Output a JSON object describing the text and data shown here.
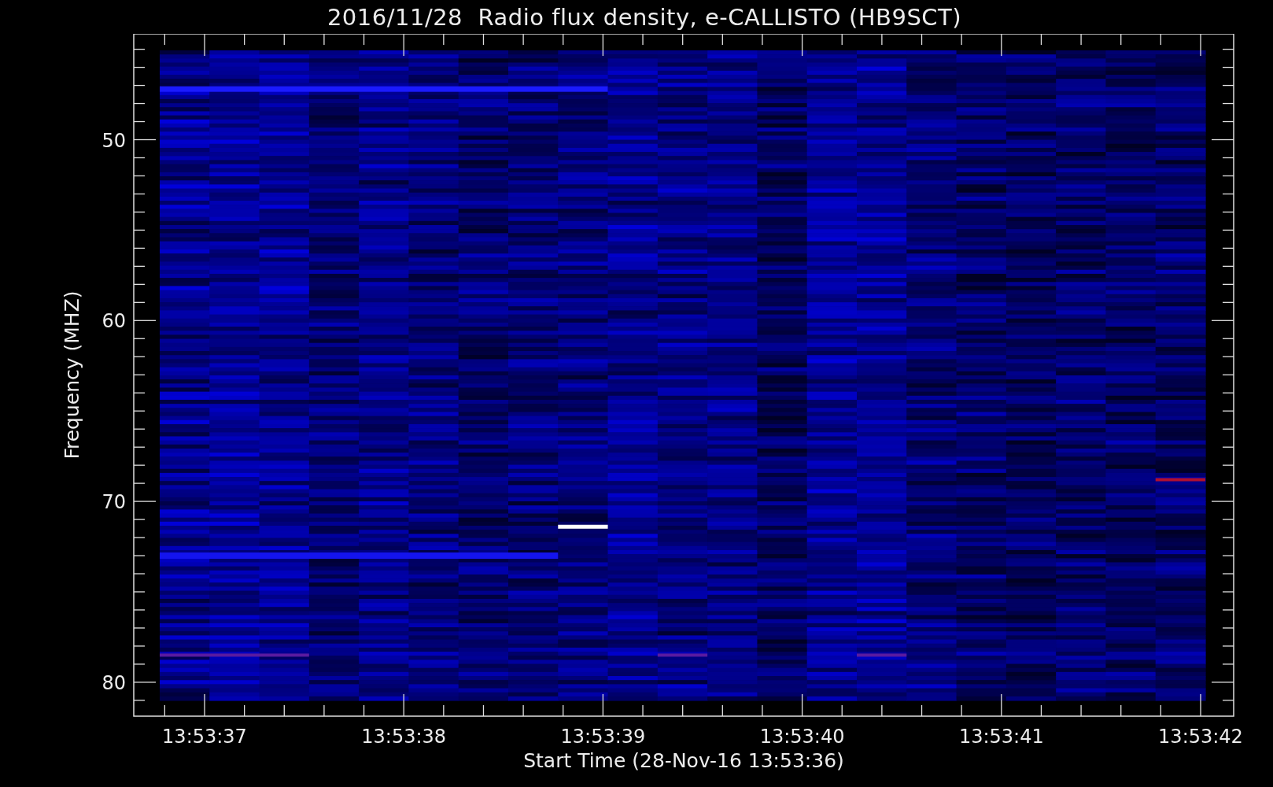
{
  "title": "2016/11/28  Radio flux density, e-CALLISTO (HB9SCT)",
  "y_axis": {
    "label": "Frequency (MHZ)",
    "ticks": [
      "50",
      "60",
      "70",
      "80"
    ]
  },
  "x_axis": {
    "label": "Start Time (28-Nov-16 13:53:36)",
    "ticks": [
      "13:53:37",
      "13:53:38",
      "13:53:39",
      "13:53:40",
      "13:53:41",
      "13:53:42"
    ]
  }
}
